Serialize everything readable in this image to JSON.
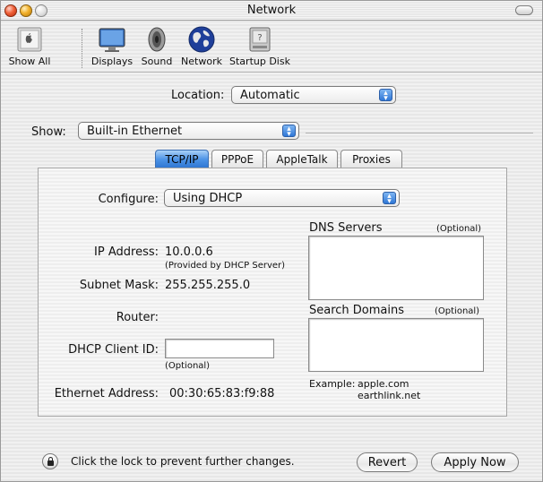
{
  "window": {
    "title": "Network"
  },
  "toolbar": {
    "items": [
      {
        "label": "Show All",
        "icon": "show-all-icon"
      },
      {
        "label": "Displays",
        "icon": "displays-icon"
      },
      {
        "label": "Sound",
        "icon": "sound-icon"
      },
      {
        "label": "Network",
        "icon": "network-globe-icon"
      },
      {
        "label": "Startup Disk",
        "icon": "startup-disk-icon"
      }
    ]
  },
  "location": {
    "label": "Location:",
    "value": "Automatic"
  },
  "show": {
    "label": "Show:",
    "value": "Built-in Ethernet"
  },
  "tabs": [
    {
      "label": "TCP/IP",
      "active": true
    },
    {
      "label": "PPPoE",
      "active": false
    },
    {
      "label": "AppleTalk",
      "active": false
    },
    {
      "label": "Proxies",
      "active": false
    }
  ],
  "tcpip": {
    "configure_label": "Configure:",
    "configure_value": "Using DHCP",
    "ip_label": "IP Address:",
    "ip_value": "10.0.0.6",
    "ip_note": "(Provided by DHCP Server)",
    "subnet_label": "Subnet Mask:",
    "subnet_value": "255.255.255.0",
    "router_label": "Router:",
    "router_value": "",
    "dhcp_label": "DHCP Client ID:",
    "dhcp_value": "",
    "dhcp_note": "(Optional)",
    "ethernet_label": "Ethernet Address:",
    "ethernet_value": "00:30:65:83:f9:88",
    "dns_label": "DNS Servers",
    "dns_optional": "(Optional)",
    "dns_value": "",
    "search_label": "Search Domains",
    "search_optional": "(Optional)",
    "search_value": "",
    "example_label": "Example:",
    "example_line1": "apple.com",
    "example_line2": "earthlink.net"
  },
  "footer": {
    "lock_text": "Click the lock to prevent further changes.",
    "revert_label": "Revert",
    "apply_label": "Apply Now"
  },
  "colors": {
    "accent": "#3b82d8",
    "window_bg": "#ececec"
  }
}
